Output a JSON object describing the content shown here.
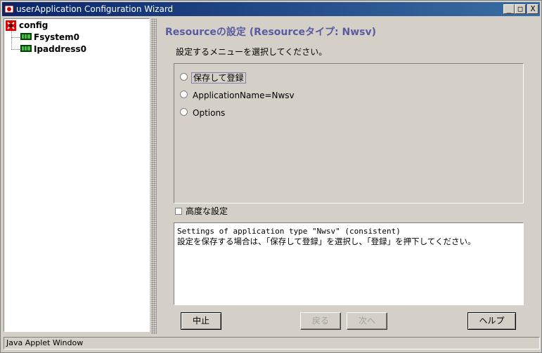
{
  "window": {
    "title": "userApplication Configuration Wizard",
    "controls": {
      "minimize": "_",
      "maximize": "□",
      "close": "X"
    }
  },
  "tree": {
    "root": {
      "label": "config",
      "icon": "config-icon",
      "color": "#cc0000"
    },
    "children": [
      {
        "label": "Fsystem0",
        "icon": "resource-icon"
      },
      {
        "label": "Ipaddress0",
        "icon": "resource-icon"
      }
    ]
  },
  "main": {
    "heading": "Resourceの設定 (Resourceタイプ: Nwsv)",
    "heading_color": "#5a5aa0",
    "prompt": "設定するメニューを選択してください。",
    "options": [
      {
        "label": "保存して登録"
      },
      {
        "label": "ApplicationName=Nwsv"
      },
      {
        "label": "Options"
      }
    ],
    "advanced_label": "高度な設定",
    "description": [
      "Settings of application type \"Nwsv\" (consistent)",
      "設定を保存する場合は、「保存して登録」を選択し、「登録」を押下してください。"
    ]
  },
  "buttons": {
    "cancel": "中止",
    "back": "戻る",
    "next": "次へ",
    "help": "ヘルプ"
  },
  "status": "Java Applet Window"
}
